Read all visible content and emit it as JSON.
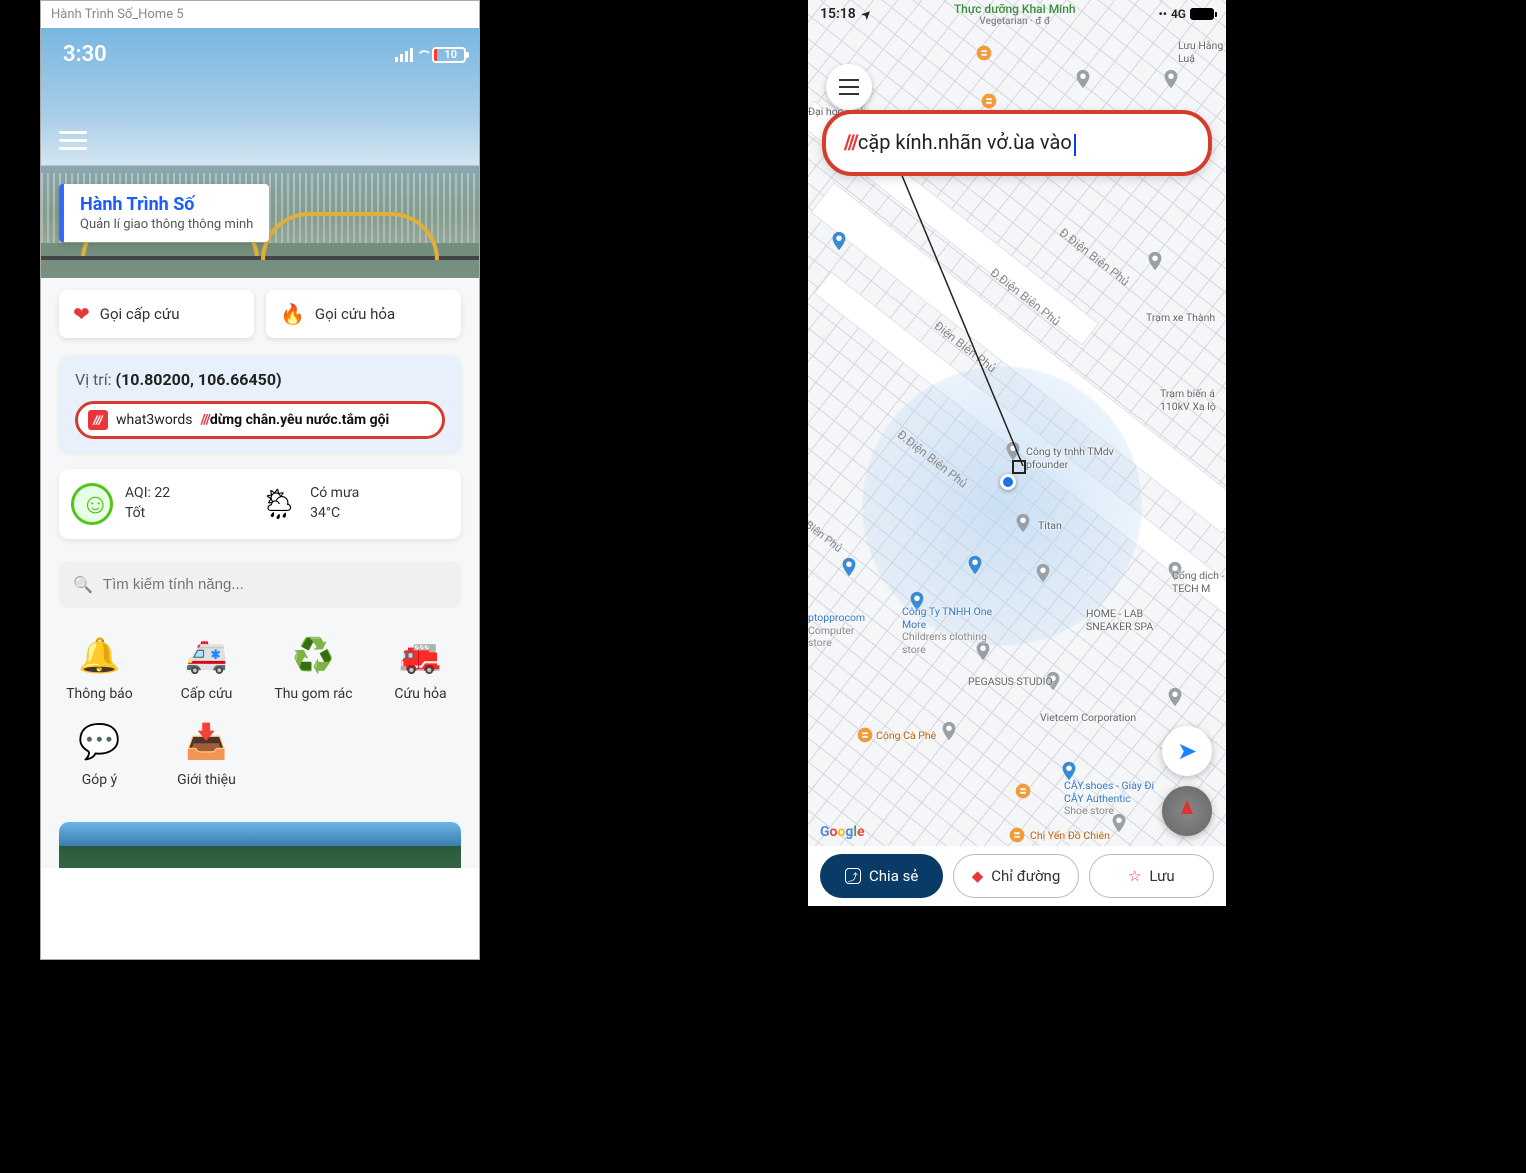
{
  "left": {
    "design_label": "Hành Trình Số_Home 5",
    "status": {
      "time": "3:30",
      "battery_pct": "10"
    },
    "title": {
      "name": "Hành Trình Số",
      "subtitle": "Quản lí giao thông thông minh"
    },
    "emergency": {
      "ambulance": "Gọi cấp cứu",
      "fire": "Gọi cứu hỏa"
    },
    "location": {
      "label": "Vị trí:",
      "coords": "(10.80200, 106.66450)",
      "w3w_brand": "what3words",
      "w3w_address": "dừng chân.yêu nước.tắm gội"
    },
    "env": {
      "aqi_label": "AQI: 22",
      "aqi_status": "Tốt",
      "weather_label": "Có mưa",
      "weather_temp": "34°C"
    },
    "search_placeholder": "Tìm kiếm tính năng...",
    "features_row1": [
      {
        "icon": "🔔",
        "label": "Thông báo"
      },
      {
        "icon": "🚑",
        "label": "Cấp cứu"
      },
      {
        "icon": "♻️",
        "label": "Thu gom rác"
      },
      {
        "icon": "🚒",
        "label": "Cứu hỏa"
      }
    ],
    "features_row2": [
      {
        "icon": "💬",
        "label": "Góp ý"
      },
      {
        "icon": "📥",
        "label": "Giới thiệu"
      }
    ]
  },
  "right": {
    "status": {
      "time": "15:18",
      "header_title": "Thực dưỡng Khai Minh",
      "header_sub": "Vegetarian · đ đ",
      "network": "4G"
    },
    "search": {
      "address": "cặp kính.nhãn vở.ùa vào"
    },
    "roads": {
      "dbp1": "Điện Biên Phủ",
      "dbp2": "Đ.Điện Biên Phủ",
      "dbp3": "Đ.Điện Biên Phủ",
      "dbp4": "Đ.Điện Biên Phủ"
    },
    "pois": {
      "dhkinh": "Đại học Kinh",
      "luu": "Lưu\nHằng Luậ",
      "pfounder": "Công ty tnhh\nTMdv pfounder",
      "titan": "Titan",
      "onemore": "Công Ty TNHH\nOne More",
      "onemore_sub": "Children's clothing store",
      "toppro": "ptopprocom",
      "toppro_sub": "Computer store",
      "pegasus": "PEGASUS STUDIO",
      "vietcem": "Vietcem Corporation",
      "congdich": "Cổng dịch\n- TECH M",
      "homelab": "HOME - LAB\nSNEAKER SPA",
      "caphe": "Cộng Cà Phê",
      "cayshoes": "CÂY.shoes - Giày\nĐi CÂY Authentic",
      "cayshoes_sub": "Shoe store",
      "chiyen": "Chị Yến Đồ Chiên",
      "tramxe": "Trạm xe Thành",
      "trambien": "Trạm biến á\n110kV Xa lộ"
    },
    "google": "Google",
    "actions": {
      "share": "Chia sẻ",
      "directions": "Chỉ đường",
      "save": "Lưu"
    }
  }
}
